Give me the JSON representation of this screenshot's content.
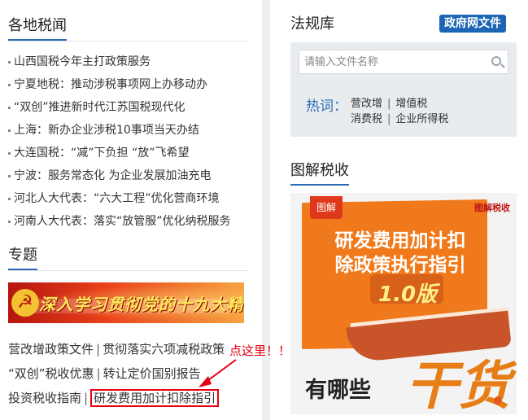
{
  "left": {
    "news_title": "各地税闻",
    "news": [
      "山西国税今年主打政策服务",
      "宁夏地税：推动涉税事项网上办移动办",
      "“双创”推进新时代江苏国税现代化",
      "上海：新办企业涉税10事项当天办结",
      "大连国税：“减”下负担 “放”飞希望",
      "宁波：服务常态化 为企业发展加油充电",
      "河北人大代表：“六大工程”优化营商环境",
      "河南人大代表：落实“放管服”优化纳税服务"
    ],
    "topic_title": "专题",
    "banner_text": "深入学习贯彻党的十九大精神",
    "links": {
      "row1_a": "营改增政策文件",
      "row1_b": "贯彻落实六项减税政策",
      "row2_a": "“双创”税收优惠",
      "row2_b": "转让定价国别报告",
      "row3_a": "投资税收指南",
      "row3_b": "研发费用加计扣除指引",
      "sep": "|"
    },
    "annotation": "点这里！！"
  },
  "right": {
    "law_title": "法规库",
    "gov_badge": "政府网文件",
    "search": {
      "placeholder": "请输入文件名称",
      "value": ""
    },
    "hot_label": "热词：",
    "hot_row1": [
      "营改增",
      "增值税"
    ],
    "hot_row2": [
      "消费税",
      "企业所得税"
    ],
    "hot_sep": "|",
    "graphic_title": "图解税收",
    "poster": {
      "tag": "图解",
      "logo": "图解税收",
      "line1": "研发费用加计扣",
      "line2": "除政策执行指引",
      "version": "1.0版",
      "question": "有哪些",
      "big": "干货"
    }
  },
  "colors": {
    "accent_blue": "#2b6cb5",
    "highlight_red": "#e60012",
    "panel_gray": "#e9ecef"
  }
}
